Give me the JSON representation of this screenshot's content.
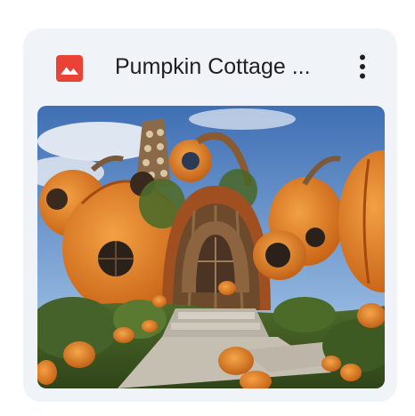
{
  "card": {
    "title": "Pumpkin Cottage ...",
    "file_type_icon": "image-file-icon",
    "menu_icon": "more-vert-icon"
  },
  "thumbnail": {
    "subject": "pumpkin-cottage-image"
  },
  "colors": {
    "card_bg": "#f0f4f9",
    "icon_red": "#ea4335",
    "title_text": "#1f1f1f",
    "pumpkin_orange": "#e07a1f"
  }
}
